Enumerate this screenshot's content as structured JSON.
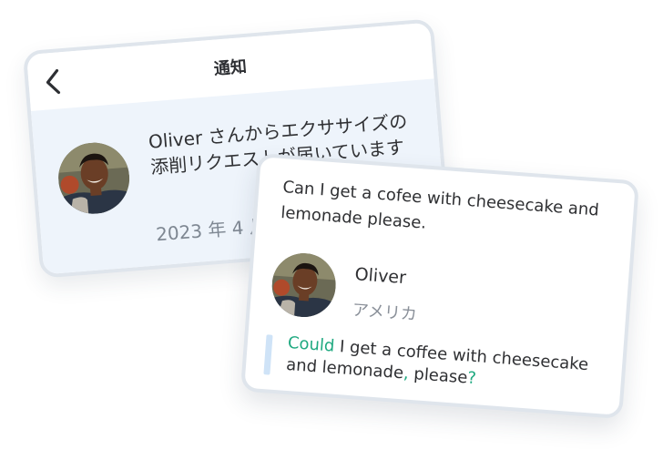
{
  "notification_card": {
    "title": "通知",
    "back_icon": "chevron-left-icon",
    "message": "Oliver さんからエクササイズの添削リクエストが届いています",
    "date": "2023 年 4 月",
    "avatar_icon": "user-avatar"
  },
  "correction_card": {
    "original_text": "Can I get a cofee with cheesecake and lemonade please.",
    "user": {
      "name": "Oliver",
      "country": "アメリカ",
      "avatar_icon": "user-avatar"
    },
    "corrected": {
      "part1_added": "Could",
      "part2": " I get a cof",
      "part3_added": "f",
      "part4": "ee with cheesecake and lemonade",
      "part5_added": ",",
      "part6": " please",
      "part7_added": "?"
    }
  },
  "colors": {
    "correction_highlight": "#1fa980",
    "quote_bar": "#cfe3f7",
    "notification_background": "#eef4fb",
    "card_border": "#dfe5ec"
  }
}
